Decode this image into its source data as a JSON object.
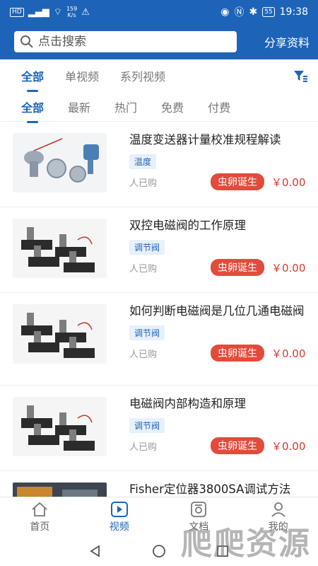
{
  "status": {
    "hd": "HD",
    "net": "4G",
    "speed": "159",
    "speed_unit": "K/s",
    "battery": "55",
    "time": "19:38"
  },
  "header": {
    "search_placeholder": "点击搜索",
    "share_label": "分享资料"
  },
  "tabs_primary": [
    "全部",
    "单视频",
    "系列视频"
  ],
  "tabs_secondary": [
    "全部",
    "最新",
    "热门",
    "免费",
    "付费"
  ],
  "items": [
    {
      "title": "温度变送器计量校准规程解读",
      "tag": "温度",
      "bought": "人已购",
      "badge": "虫卵诞生",
      "price": "￥0.00"
    },
    {
      "title": "双控电磁阀的工作原理",
      "tag": "调节阀",
      "bought": "人已购",
      "badge": "虫卵诞生",
      "price": "￥0.00"
    },
    {
      "title": "如何判断电磁阀是几位几通电磁阀",
      "tag": "调节阀",
      "bought": "人已购",
      "badge": "虫卵诞生",
      "price": "￥0.00"
    },
    {
      "title": "电磁阀内部构造和原理",
      "tag": "调节阀",
      "bought": "人已购",
      "badge": "虫卵诞生",
      "price": "￥0.00"
    },
    {
      "title": "Fisher定位器3800SA调试方法"
    }
  ],
  "bottom_nav": [
    "首页",
    "视频",
    "文档",
    "我的"
  ],
  "watermark": "爬爬资源",
  "colors": {
    "brand": "#1d64b8",
    "badge": "#e24b3b",
    "price": "#d8392b"
  }
}
